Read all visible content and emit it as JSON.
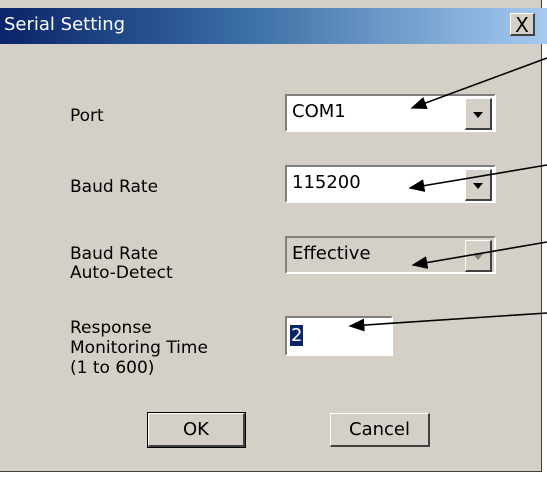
{
  "window": {
    "title": "Serial Setting",
    "close_glyph": "X"
  },
  "fields": {
    "port": {
      "label": "Port",
      "value": "COM1"
    },
    "baud_rate": {
      "label": "Baud Rate",
      "value": "115200"
    },
    "auto_detect": {
      "label_line1": "Baud Rate",
      "label_line2": "Auto-Detect",
      "value": "Effective"
    },
    "response_time": {
      "label_line1": "Response",
      "label_line2": "Monitoring Time",
      "label_line3": "(1 to 600)",
      "value": "2"
    }
  },
  "buttons": {
    "ok": "OK",
    "cancel": "Cancel"
  },
  "icons": {
    "dropdown": "chevron-down-icon",
    "close": "close-icon",
    "pointer": "arrow-icon"
  },
  "colors": {
    "title_start": "#0a246a",
    "title_end": "#a6caf0",
    "dialog_bg": "#d4d0c8"
  }
}
